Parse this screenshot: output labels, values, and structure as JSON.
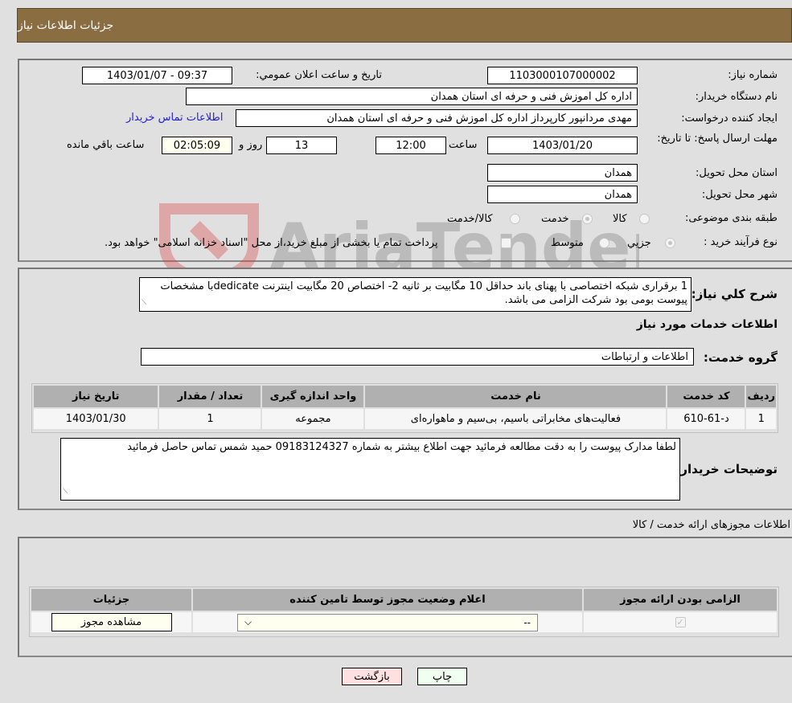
{
  "header": {
    "title": "جزئیات اطلاعات نیاز"
  },
  "details": {
    "need_number_label": "شماره نیاز:",
    "need_number": "1103000107000002",
    "announce_label": "تاريخ و ساعت اعلان عمومي:",
    "announce_value": "1403/01/07 - 09:37",
    "buyer_org_label": "نام دستگاه خريدار:",
    "buyer_org": "اداره کل اموزش فنی و حرفه ای استان همدان",
    "creator_label": "ايجاد کننده درخواست:",
    "creator": "مهدی مردانپور کارپرداز اداره کل اموزش فنی و حرفه ای استان همدان",
    "contact_link": "اطلاعات تماس خريدار",
    "deadline_label": "مهلت ارسال پاسخ: تا تاريخ:",
    "deadline_date": "1403/01/20",
    "time_label": "ساعت",
    "deadline_time": "12:00",
    "days_value": "13",
    "days_label": "روز و",
    "remaining_value": "02:05:09",
    "remaining_label": "ساعت باقي مانده",
    "province_label": "استان محل تحويل:",
    "province": "همدان",
    "city_label": "شهر محل تحويل:",
    "city": "همدان",
    "category_label": "طبقه بندی موضوعی:",
    "category_options": [
      {
        "label": "کالا",
        "selected": false
      },
      {
        "label": "خدمت",
        "selected": true
      },
      {
        "label": "کالا/خدمت",
        "selected": false
      }
    ],
    "purchase_type_label": "نوع فرآيند خريد :",
    "purchase_type_options": [
      {
        "label": "جزيي",
        "selected": true
      },
      {
        "label": "متوسط",
        "selected": false
      }
    ],
    "treasury_checkbox_checked": false,
    "treasury_text": "پرداخت تمام يا بخشی از مبلغ خريد،از محل \"اسناد خزانه اسلامی\" خواهد بود."
  },
  "description": {
    "label": "شرح کلي نياز:",
    "text": "1 برقراری شبکه اختصاصی با پهنای باند حداقل 10 مگابیت بر ثانیه 2- اختصاص 20 مگابیت اینترنت  dedicateبا مشخصات پیوست بومی بود شرکت  الزامی می باشد."
  },
  "services": {
    "section_title": "اطلاعات خدمات مورد نياز",
    "group_label": "گروه خدمت:",
    "group_value": "اطلاعات و ارتباطات",
    "columns": [
      "رديف",
      "کد خدمت",
      "نام خدمت",
      "واحد اندازه گيری",
      "تعداد / مقدار",
      "تاريخ نياز"
    ],
    "rows": [
      [
        "1",
        "د-61-610",
        "فعالیت‌های مخابراتی باسیم، بی‌سیم و ماهواره‌ای",
        "مجموعه",
        "1",
        "1403/01/30"
      ]
    ]
  },
  "buyer_notes": {
    "label": "توضيحات خريدار:",
    "text": "لطفا مدارک پیوست را به دقت مطالعه فرمائید جهت اطلاع بیشتر به شماره 09183124327  حمید شمس تماس حاصل فرمائید"
  },
  "permits": {
    "section_title": "اطلاعات مجوزهای ارائه خدمت / کالا",
    "columns": [
      "الزامی بودن ارائه مجوز",
      "اعلام وضعيت مجوز توسط تامين کننده",
      "جزئيات"
    ],
    "row": {
      "required_checked": true,
      "status_select": "--",
      "view_button": "مشاهده مجوز"
    }
  },
  "footer": {
    "print_button": "چاپ",
    "back_button": "بازگشت"
  },
  "watermark": {
    "text": "AriaTender.neT"
  },
  "colors": {
    "header_bg": "#8b6d42",
    "link": "#2222cc",
    "back_button_bg": "#ffe0e0",
    "print_button_bg": "#f0fff0"
  }
}
